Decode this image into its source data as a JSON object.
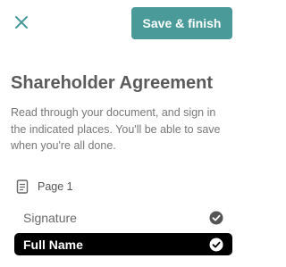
{
  "header": {
    "close_icon": "close-icon",
    "save_label": "Save & finish",
    "accent_color": "#4a9a9a"
  },
  "document": {
    "title": "Shareholder Agreement",
    "instructions": "Read through your document, and sign in the indicated places. You'll be able to save when you're all done."
  },
  "fields": {
    "page_icon": "document-icon",
    "page_label": "Page 1",
    "items": [
      {
        "label": "Signature",
        "completed": true,
        "selected": false,
        "icon": "check-circle-icon"
      },
      {
        "label": "Full Name",
        "completed": true,
        "selected": true,
        "icon": "check-circle-icon"
      }
    ]
  }
}
